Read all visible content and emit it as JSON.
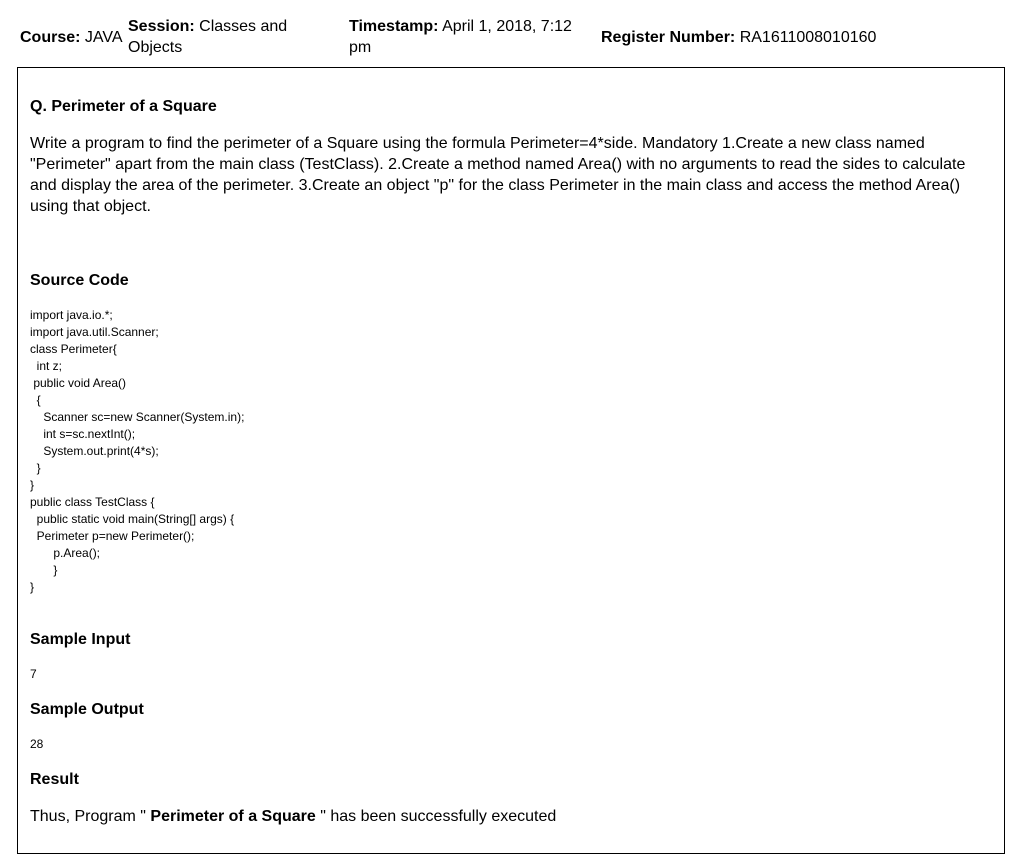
{
  "header": {
    "course_label": "Course:",
    "course_value": "JAVA",
    "session_label": "Session:",
    "session_value": "Classes and Objects",
    "timestamp_label": "Timestamp:",
    "timestamp_value": "April 1, 2018, 7:12 pm",
    "register_label": "Register Number:",
    "register_value": "RA1611008010160"
  },
  "question": {
    "title": "Q. Perimeter of a Square",
    "body": "Write a program to find the perimeter of a Square using the formula Perimeter=4*side. Mandatory 1.Create a new class named \"Perimeter\" apart from the main class (TestClass). 2.Create a method named Area() with no arguments to read the sides to calculate and display the area of the perimeter. 3.Create an object \"p\" for the class Perimeter in the main class and access the method Area() using that object."
  },
  "source": {
    "heading": "Source Code",
    "code": "import java.io.*;\nimport java.util.Scanner;\nclass Perimeter{\n  int z;\n public void Area()\n  {\n    Scanner sc=new Scanner(System.in);\n    int s=sc.nextInt();\n    System.out.print(4*s);\n  }\n}\npublic class TestClass {\n  public static void main(String[] args) {\n  Perimeter p=new Perimeter();\n       p.Area();\n       }\n}"
  },
  "sample_input": {
    "heading": "Sample Input",
    "value": "7"
  },
  "sample_output": {
    "heading": "Sample Output",
    "value": "28"
  },
  "result": {
    "heading": "Result",
    "prefix": "Thus, Program \" ",
    "program_name": "Perimeter of a Square",
    "suffix": " \" has been successfully executed"
  }
}
